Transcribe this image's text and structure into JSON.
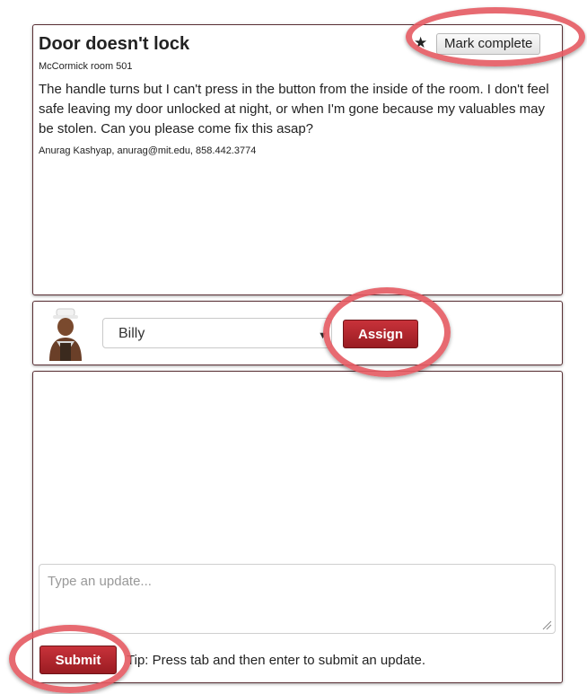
{
  "issue": {
    "title": "Door doesn't lock",
    "location": "McCormick room 501",
    "description": "The handle turns but I can't press in the button from the inside of the room. I don't feel safe leaving my door unlocked at night, or when I'm gone because my valuables may be stolen. Can you please come fix this asap?",
    "contact": "Anurag Kashyap, anurag@mit.edu, 858.442.3774",
    "star_glyph": "★",
    "mark_complete_label": "Mark complete"
  },
  "assign": {
    "selected_worker": "Billy",
    "assign_label": "Assign"
  },
  "updates": {
    "placeholder": "Type an update...",
    "submit_label": "Submit",
    "tip": "Tip: Press tab and then enter to submit an update."
  },
  "colors": {
    "accent_red": "#b0252c",
    "highlight_ring": "#e45a62",
    "panel_border": "#5a3035"
  },
  "icons": [
    "star-icon",
    "avatar-image",
    "dropdown-arrow-icon",
    "resize-grip-icon"
  ]
}
